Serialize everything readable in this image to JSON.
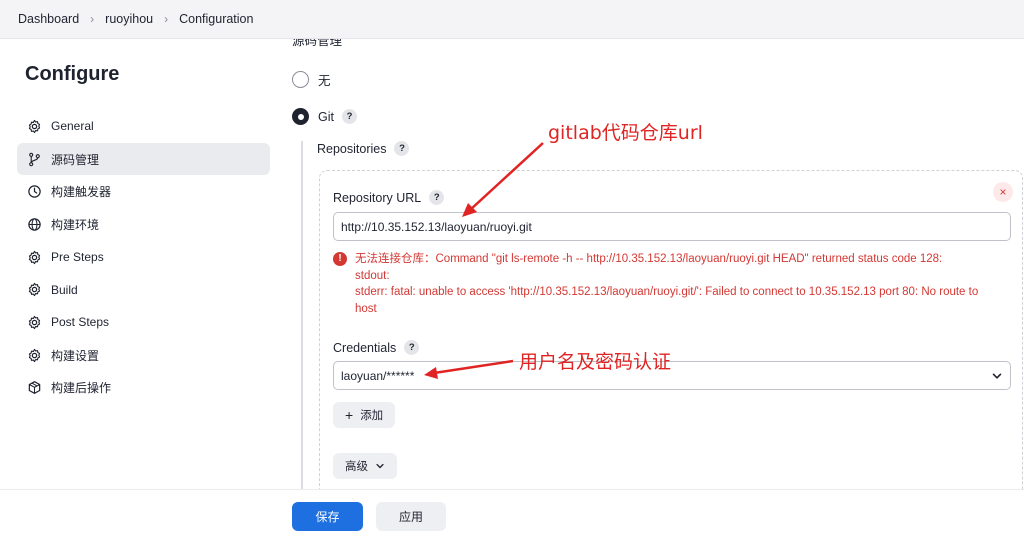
{
  "breadcrumb": [
    {
      "label": "Dashboard"
    },
    {
      "label": "ruoyihou"
    },
    {
      "label": "Configuration"
    }
  ],
  "sidebar": {
    "title": "Configure",
    "items": [
      {
        "label": "General",
        "icon": "gear-icon"
      },
      {
        "label": "源码管理",
        "icon": "branch-icon",
        "active": true
      },
      {
        "label": "构建触发器",
        "icon": "clock-icon"
      },
      {
        "label": "构建环境",
        "icon": "globe-icon"
      },
      {
        "label": "Pre Steps",
        "icon": "gear-icon"
      },
      {
        "label": "Build",
        "icon": "gear-icon"
      },
      {
        "label": "Post Steps",
        "icon": "gear-icon"
      },
      {
        "label": "构建设置",
        "icon": "gear-icon"
      },
      {
        "label": "构建后操作",
        "icon": "package-icon"
      }
    ]
  },
  "scm": {
    "cutoff_heading": "源码管理",
    "options": [
      {
        "label": "无",
        "checked": false
      },
      {
        "label": "Git",
        "checked": true
      }
    ],
    "help_glyph": "?",
    "repositories_label": "Repositories",
    "repo": {
      "close_glyph": "×",
      "url_label": "Repository URL",
      "url_value": "http://10.35.152.13/laoyuan/ruoyi.git",
      "error_icon": "!",
      "error_lines": [
        "无法连接仓库：Command \"git ls-remote -h -- http://10.35.152.13/laoyuan/ruoyi.git HEAD\" returned status code 128:",
        "stdout:",
        "stderr: fatal: unable to access 'http://10.35.152.13/laoyuan/ruoyi.git/': Failed to connect to 10.35.152.13 port 80: No route to",
        "host"
      ],
      "credentials_label": "Credentials",
      "credentials_value": "laoyuan/******",
      "add_label": "添加",
      "add_glyph": "+",
      "advanced_label": "高级"
    }
  },
  "footer": {
    "save_label": "保存",
    "apply_label": "应用"
  },
  "annotations": {
    "url_note": "gitlab代码仓库url",
    "cred_note": "用户名及密码认证",
    "color": "#e02424"
  },
  "colors": {
    "primary": "#1e6fe0",
    "error": "#d33833"
  }
}
